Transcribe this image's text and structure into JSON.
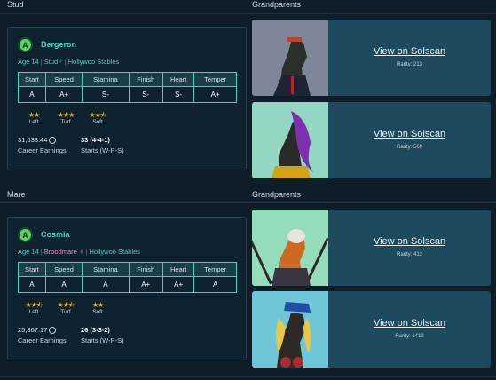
{
  "stud": {
    "section_label": "Stud",
    "badge": "A",
    "name": "Bergeron",
    "age": "Age 14",
    "type": "Stud",
    "sex_symbol": "♂",
    "stable": "Hollywoo Stables",
    "stats_headers": [
      "Start",
      "Speed",
      "Stamina",
      "Finish",
      "Heart",
      "Temper"
    ],
    "stats_values": [
      "A",
      "A+",
      "S-",
      "S-",
      "S-",
      "A+"
    ],
    "surfaces": [
      {
        "label": "Left",
        "stars": "★★"
      },
      {
        "label": "Turf",
        "stars": "★★★"
      },
      {
        "label": "Soft",
        "stars": "★★⯪"
      }
    ],
    "earnings": "31,633.44",
    "earnings_label": "Career Earnings",
    "starts": "33 (4-4-1)",
    "starts_label": "Starts (W-P-S)"
  },
  "mare": {
    "section_label": "Mare",
    "badge": "A",
    "name": "Cosmia",
    "age": "Age 14",
    "type": "Broodmare",
    "sex_symbol": "♀",
    "stable": "Hollywoo Stables",
    "stats_headers": [
      "Start",
      "Speed",
      "Stamina",
      "Finish",
      "Heart",
      "Temper"
    ],
    "stats_values": [
      "A",
      "A",
      "A",
      "A+",
      "A+",
      "A"
    ],
    "surfaces": [
      {
        "label": "Left",
        "stars": "★★⯪"
      },
      {
        "label": "Turf",
        "stars": "★★⯪"
      },
      {
        "label": "Soft",
        "stars": "★★"
      }
    ],
    "earnings": "25,867.17",
    "earnings_label": "Career Earnings",
    "starts": "26 (3-3-2)",
    "starts_label": "Starts (W-P-S)"
  },
  "grandparents_label": "Grandparents",
  "grandparents": [
    {
      "link": "View on Solscan",
      "rarity": "Rarity: 213",
      "bg": "#7a8596"
    },
    {
      "link": "View on Solscan",
      "rarity": "Rarity: 569",
      "bg": "#8fd3c0"
    },
    {
      "link": "View on Solscan",
      "rarity": "Rarity: 412",
      "bg": "#8fd9b6"
    },
    {
      "link": "View on Solscan",
      "rarity": "Rarity: 1413",
      "bg": "#6fc4d6"
    }
  ]
}
